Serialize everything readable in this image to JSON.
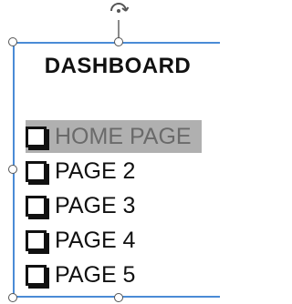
{
  "dashboard": {
    "title": "DASHBOARD",
    "items": [
      {
        "label": "HOME PAGE",
        "selected": true
      },
      {
        "label": "PAGE 2",
        "selected": false
      },
      {
        "label": "PAGE 3",
        "selected": false
      },
      {
        "label": "PAGE 4",
        "selected": false
      },
      {
        "label": "PAGE 5",
        "selected": false
      }
    ]
  },
  "colors": {
    "selection_border": "#4a8bd6",
    "highlight_background": "#b0b0b0",
    "highlight_text": "#6a6a6a",
    "text": "#111111"
  },
  "icons": {
    "rotate_handle": "rotate-icon",
    "checkbox": "checkbox-icon"
  }
}
